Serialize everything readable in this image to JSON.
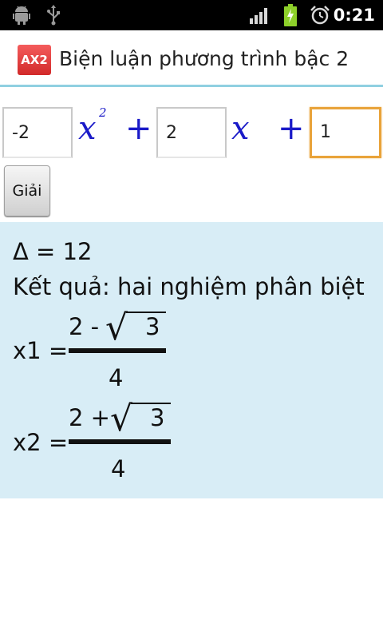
{
  "status_bar": {
    "time": "0:21",
    "icons": [
      "android-debug-icon",
      "usb-icon",
      "signal-icon",
      "battery-charging-icon",
      "alarm-icon"
    ]
  },
  "app": {
    "icon_text": "AX2",
    "title": "Biện luận phương trình bậc 2"
  },
  "equation": {
    "a": "-2",
    "b": "2",
    "c": "1",
    "var": "x",
    "exponent": "2",
    "plus": "+"
  },
  "solve_button": {
    "label": "Giải"
  },
  "result": {
    "delta_line": "Δ = 12",
    "conclusion": "Kết quả: hai nghiệm phân biệt",
    "x1_label": "x1 =",
    "x1_num_a": "2 -",
    "x1_num_radicand": "3",
    "x1_den": "4",
    "x2_label": "x2 =",
    "x2_num_a": "2 +",
    "x2_num_radicand": "3",
    "x2_den": "4",
    "sqrt_symbol": "√"
  },
  "colors": {
    "status_bar_bg": "#000000",
    "title_divider": "#8fd0e1",
    "math_blue": "#1a1ac8",
    "focus_orange": "#e9a33a",
    "result_bg": "#d8edf6",
    "app_icon_red": "#e03b3b",
    "battery_green": "#8ed02a"
  }
}
